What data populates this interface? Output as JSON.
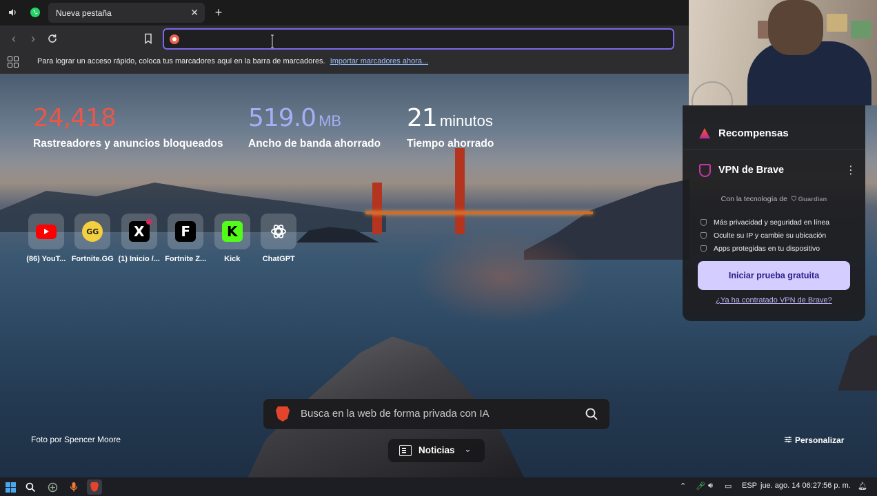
{
  "tabs": [
    {
      "title": "Nueva pestaña"
    }
  ],
  "bookmarks_bar": {
    "message": "Para lograr un acceso rápido, coloca tus marcadores aquí en la barra de marcadores.",
    "import_link": "Importar marcadores ahora..."
  },
  "address_bar": {
    "value": "",
    "placeholder": ""
  },
  "stats": {
    "trackers": {
      "value": "24,418",
      "unit": "",
      "label": "Rastreadores y anuncios bloqueados",
      "color": "#e8574a"
    },
    "bandwidth": {
      "value": "519.0",
      "unit": "MB",
      "label": "Ancho de banda ahorrado",
      "color": "#a9adf5"
    },
    "time": {
      "value": "21",
      "unit": "minutos",
      "label": "Tiempo ahorrado",
      "color": "#ffffff"
    }
  },
  "top_sites": [
    {
      "label": "(86) YouT...",
      "icon": "youtube-icon"
    },
    {
      "label": "Fortnite.GG",
      "icon": "fortnite-gg-icon"
    },
    {
      "label": "(1) Inicio /...",
      "icon": "x-icon"
    },
    {
      "label": "Fortnite Z...",
      "icon": "fortnite-z-icon"
    },
    {
      "label": "Kick",
      "icon": "kick-icon"
    },
    {
      "label": "ChatGPT",
      "icon": "chatgpt-icon"
    }
  ],
  "search": {
    "placeholder": "Busca en la web de forma privada con IA"
  },
  "news": {
    "label": "Noticias"
  },
  "photo_credit": "Foto por Spencer Moore",
  "customize": {
    "label": "Personalizar"
  },
  "rewards_panel": {
    "rewards_title": "Recompensas",
    "vpn_title": "VPN de Brave",
    "powered_by": "Con la tecnología de",
    "powered_brand": "Guardian",
    "features": [
      "Más privacidad y seguridad en línea",
      "Oculte su IP y cambie su ubicación",
      "Apps protegidas en tu dispositivo"
    ],
    "cta": "Iniciar prueba gratuita",
    "already": "¿Ya ha contratado VPN de Brave?"
  },
  "taskbar": {
    "language": "ESP",
    "datetime": "jue. ago. 14  06:27:56 p. m."
  },
  "colors": {
    "accent": "#7a69e8",
    "brave": "#e2452b"
  }
}
